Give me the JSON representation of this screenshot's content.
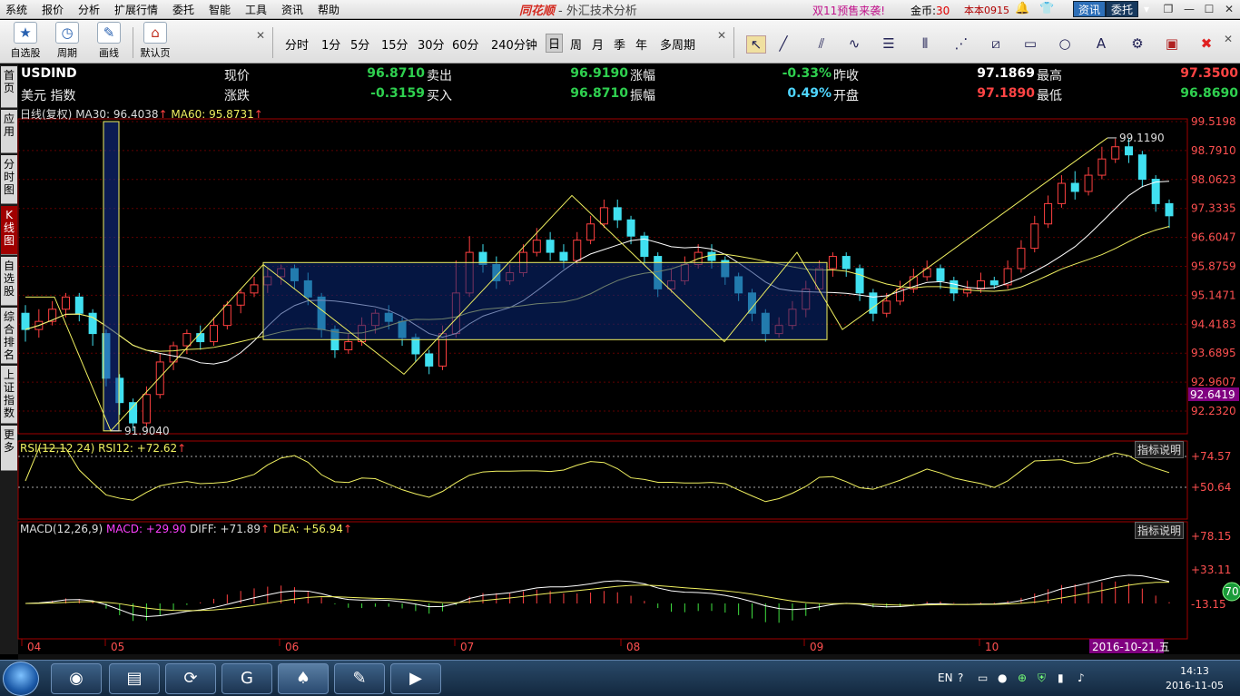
{
  "menubar": {
    "items": [
      "系统",
      "报价",
      "分析",
      "扩展行情",
      "委托",
      "智能",
      "工具",
      "资讯",
      "帮助"
    ],
    "brand": "同花顺",
    "subtitle": "- 外汇技术分析",
    "promo": "双11预售来袭!",
    "gold_label": "金币:",
    "gold_value": "30",
    "version": "本本0915",
    "news_button": "资讯",
    "trade_button": "委托"
  },
  "toolbar": {
    "tools": [
      {
        "label": "自选股",
        "icon": "star-icon"
      },
      {
        "label": "周期",
        "icon": "clock-icon"
      },
      {
        "label": "画线",
        "icon": "pen-icon"
      },
      {
        "label": "默认页",
        "icon": "home-icon"
      }
    ],
    "periods": [
      "分时",
      "1分",
      "5分",
      "15分",
      "30分",
      "60分",
      "240分钟",
      "日",
      "周",
      "月",
      "季",
      "年",
      "多周期"
    ],
    "active_period": "日",
    "draw_tools": [
      "cursor-icon",
      "line-icon",
      "parallel-icon",
      "wave-icon",
      "fib-icon",
      "bars-icon",
      "fan-icon",
      "channel-icon",
      "rect-icon",
      "ellipse-icon",
      "text-icon",
      "gear-icon",
      "bookmark-icon",
      "delete-icon"
    ]
  },
  "sidebar": {
    "tabs": [
      "首页",
      "应用",
      "分时图",
      "K线图",
      "自选股",
      "综合排名",
      "上证指数",
      "更多"
    ],
    "active": "K线图"
  },
  "quote": {
    "symbol": "USDIND",
    "name": "美元 指数",
    "rows": [
      {
        "l1": "现价",
        "v1": "96.8710",
        "l2": "卖出",
        "v2": "96.9190",
        "l3": "涨幅",
        "v3": "-0.33%",
        "l4": "昨收",
        "v4": "97.1869",
        "l5": "最高",
        "v5": "97.3500"
      },
      {
        "l1": "涨跌",
        "v1": "-0.3159",
        "l2": "买入",
        "v2": "96.8710",
        "l3": "振幅",
        "v3": "0.49%",
        "l4": "开盘",
        "v4": "97.1890",
        "l5": "最低",
        "v5": "96.8690"
      }
    ]
  },
  "main_legend": {
    "title": "日线(复权)",
    "ma30": "MA30: 96.4038",
    "ma60": "MA60: 95.8731"
  },
  "rsi_legend": {
    "title": "RSI(12,12,24)",
    "value": "RSI12: +72.62",
    "help": "指标说明",
    "axis": [
      "+74.57",
      "+50.64"
    ]
  },
  "macd_legend": {
    "title": "MACD(12,26,9)",
    "macd": "MACD: +29.90",
    "diff": "DIFF: +71.89",
    "dea": "DEA: +56.94",
    "help": "指标说明",
    "axis": [
      "+78.15",
      "+33.11",
      "-13.15"
    ]
  },
  "badge": "70",
  "price_axis": [
    "99.5198",
    "98.7910",
    "98.0623",
    "97.3335",
    "96.6047",
    "95.8759",
    "95.1471",
    "94.4183",
    "93.6895",
    "92.9607",
    "92.2320"
  ],
  "current_price_tag": "92.6419",
  "annotations": {
    "high": "99.1190",
    "low": "91.9040"
  },
  "date_axis": [
    "04",
    "05",
    "06",
    "07",
    "08",
    "09",
    "10"
  ],
  "cursor_date": "2016-10-21,五",
  "chart_data": {
    "type": "candlestick",
    "price_range": [
      91.9,
      99.52
    ],
    "high": 99.119,
    "low": 91.904,
    "candles": [
      [
        94.8,
        94.4,
        95.0,
        94.1
      ],
      [
        94.4,
        94.6,
        94.9,
        94.2
      ],
      [
        94.6,
        94.9,
        95.1,
        94.5
      ],
      [
        94.9,
        95.2,
        95.3,
        94.7
      ],
      [
        95.2,
        94.8,
        95.3,
        94.6
      ],
      [
        94.8,
        94.3,
        94.9,
        94.0
      ],
      [
        94.3,
        93.2,
        94.4,
        93.0
      ],
      [
        93.2,
        92.6,
        93.3,
        92.3
      ],
      [
        92.6,
        92.1,
        92.7,
        91.9
      ],
      [
        92.1,
        92.8,
        93.0,
        92.0
      ],
      [
        92.8,
        93.6,
        93.8,
        92.7
      ],
      [
        93.6,
        94.0,
        94.1,
        93.4
      ],
      [
        94.0,
        94.3,
        94.4,
        93.8
      ],
      [
        94.3,
        94.1,
        94.5,
        93.9
      ],
      [
        94.1,
        94.5,
        94.7,
        94.0
      ],
      [
        94.5,
        95.0,
        95.1,
        94.4
      ],
      [
        95.0,
        95.3,
        95.4,
        94.8
      ],
      [
        95.3,
        95.5,
        95.7,
        95.2
      ],
      [
        95.5,
        95.7,
        95.9,
        95.3
      ],
      [
        95.7,
        95.9,
        96.0,
        95.5
      ],
      [
        95.9,
        95.6,
        96.0,
        95.4
      ],
      [
        95.6,
        95.2,
        95.8,
        95.0
      ],
      [
        95.2,
        94.4,
        95.3,
        94.2
      ],
      [
        94.4,
        93.9,
        94.5,
        93.7
      ],
      [
        93.9,
        94.1,
        94.3,
        93.8
      ],
      [
        94.1,
        94.5,
        94.7,
        94.0
      ],
      [
        94.5,
        94.8,
        94.9,
        94.3
      ],
      [
        94.8,
        94.6,
        95.0,
        94.4
      ],
      [
        94.6,
        94.2,
        94.7,
        94.0
      ],
      [
        94.2,
        93.8,
        94.3,
        93.6
      ],
      [
        93.8,
        93.5,
        93.9,
        93.3
      ],
      [
        93.5,
        94.3,
        94.5,
        93.4
      ],
      [
        94.3,
        95.3,
        96.1,
        94.2
      ],
      [
        95.3,
        96.3,
        96.7,
        95.2
      ],
      [
        96.3,
        96.0,
        96.5,
        95.8
      ],
      [
        96.0,
        95.6,
        96.2,
        95.4
      ],
      [
        95.6,
        95.8,
        96.0,
        95.5
      ],
      [
        95.8,
        96.3,
        96.5,
        95.7
      ],
      [
        96.3,
        96.6,
        96.9,
        96.2
      ],
      [
        96.6,
        96.3,
        96.8,
        96.1
      ],
      [
        96.3,
        96.1,
        96.5,
        95.9
      ],
      [
        96.1,
        96.6,
        96.8,
        96.0
      ],
      [
        96.6,
        97.0,
        97.2,
        96.5
      ],
      [
        97.0,
        97.4,
        97.6,
        96.9
      ],
      [
        97.4,
        97.1,
        97.6,
        96.9
      ],
      [
        97.1,
        96.7,
        97.2,
        96.5
      ],
      [
        96.7,
        96.2,
        96.8,
        96.0
      ],
      [
        96.2,
        95.4,
        96.3,
        95.2
      ],
      [
        95.4,
        95.6,
        95.9,
        95.3
      ],
      [
        95.6,
        96.0,
        96.2,
        95.5
      ],
      [
        96.0,
        96.3,
        96.5,
        95.9
      ],
      [
        96.3,
        96.1,
        96.5,
        95.9
      ],
      [
        96.1,
        95.7,
        96.2,
        95.5
      ],
      [
        95.7,
        95.3,
        95.8,
        95.1
      ],
      [
        95.3,
        94.8,
        95.4,
        94.6
      ],
      [
        94.8,
        94.3,
        94.9,
        94.1
      ],
      [
        94.3,
        94.5,
        94.7,
        94.2
      ],
      [
        94.5,
        94.9,
        95.1,
        94.4
      ],
      [
        94.9,
        95.4,
        95.6,
        94.7
      ],
      [
        95.4,
        95.9,
        96.1,
        95.3
      ],
      [
        95.9,
        96.2,
        96.3,
        95.7
      ],
      [
        96.2,
        95.9,
        96.3,
        95.7
      ],
      [
        95.9,
        95.3,
        96.0,
        95.1
      ],
      [
        95.3,
        94.8,
        95.4,
        94.6
      ],
      [
        94.8,
        95.1,
        95.3,
        94.7
      ],
      [
        95.1,
        95.4,
        95.6,
        95.0
      ],
      [
        95.4,
        95.7,
        95.9,
        95.3
      ],
      [
        95.7,
        95.9,
        96.1,
        95.6
      ],
      [
        95.9,
        95.6,
        96.0,
        95.4
      ],
      [
        95.6,
        95.3,
        95.7,
        95.1
      ],
      [
        95.3,
        95.4,
        95.6,
        95.2
      ],
      [
        95.4,
        95.6,
        95.8,
        95.3
      ],
      [
        95.6,
        95.5,
        95.7,
        95.4
      ],
      [
        95.5,
        95.9,
        96.1,
        95.4
      ],
      [
        95.9,
        96.4,
        96.6,
        95.8
      ],
      [
        96.4,
        97.0,
        97.2,
        96.3
      ],
      [
        97.0,
        97.5,
        97.7,
        96.9
      ],
      [
        97.5,
        98.0,
        98.2,
        97.4
      ],
      [
        98.0,
        97.8,
        98.3,
        97.6
      ],
      [
        97.8,
        98.2,
        98.4,
        97.7
      ],
      [
        98.2,
        98.6,
        98.9,
        98.1
      ],
      [
        98.6,
        98.9,
        99.1,
        98.5
      ],
      [
        98.9,
        98.7,
        99.1,
        98.5
      ],
      [
        98.7,
        98.1,
        98.8,
        97.9
      ],
      [
        98.1,
        97.5,
        98.2,
        97.3
      ],
      [
        97.5,
        97.2,
        97.6,
        96.9
      ]
    ]
  }
}
